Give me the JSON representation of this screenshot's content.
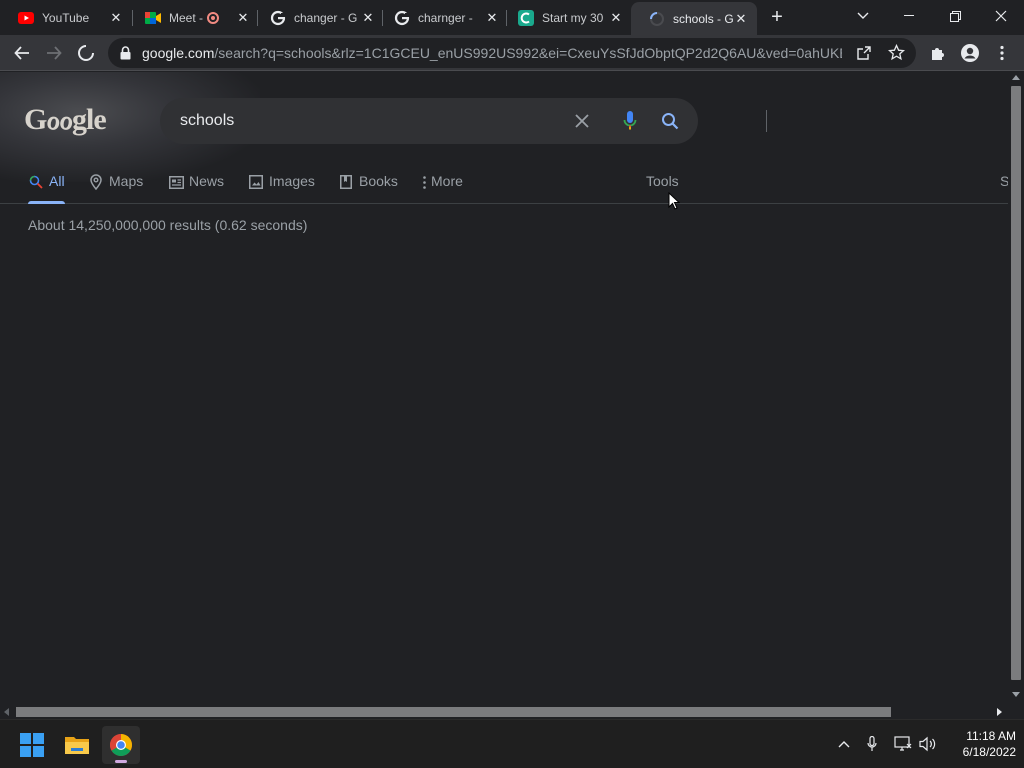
{
  "browser": {
    "tabs": [
      {
        "title": "YouTube",
        "icon": "youtube-icon"
      },
      {
        "title": "Meet - ",
        "icon": "google-meet-icon",
        "recording": true
      },
      {
        "title": "changer - G",
        "icon": "google-g-icon"
      },
      {
        "title": "charnger - ",
        "icon": "google-g-icon"
      },
      {
        "title": "Start my 30",
        "icon": "chegg-c-icon"
      },
      {
        "title": "schools - G",
        "icon": "loading-spinner-icon",
        "active": true
      }
    ],
    "url_host": "google.com",
    "url_path": "/search?q=schools&rlz=1C1GCEU_enUS992US992&ei=CxeuYsSfJdObptQP2d2Q6AU&ved=0ahUKEw..."
  },
  "search": {
    "logo_text": "Gℴℴgle",
    "query": "schools",
    "tabs": [
      {
        "label": "All",
        "icon": "search-icon",
        "active": true
      },
      {
        "label": "Maps",
        "icon": "map-pin-icon"
      },
      {
        "label": "News",
        "icon": "newspaper-icon"
      },
      {
        "label": "Images",
        "icon": "image-icon"
      },
      {
        "label": "Books",
        "icon": "book-icon"
      },
      {
        "label": "More",
        "icon": "more-vert-icon"
      }
    ],
    "tools_label": "Tools",
    "safesearch_label": "S",
    "result_stats": "About 14,250,000,000 results (0.62 seconds)"
  },
  "taskbar": {
    "time": "11:18 AM",
    "date": "6/18/2022"
  },
  "colors": {
    "background": "#202124",
    "accent": "#8ab4f8",
    "text_muted": "#9aa0a6"
  }
}
